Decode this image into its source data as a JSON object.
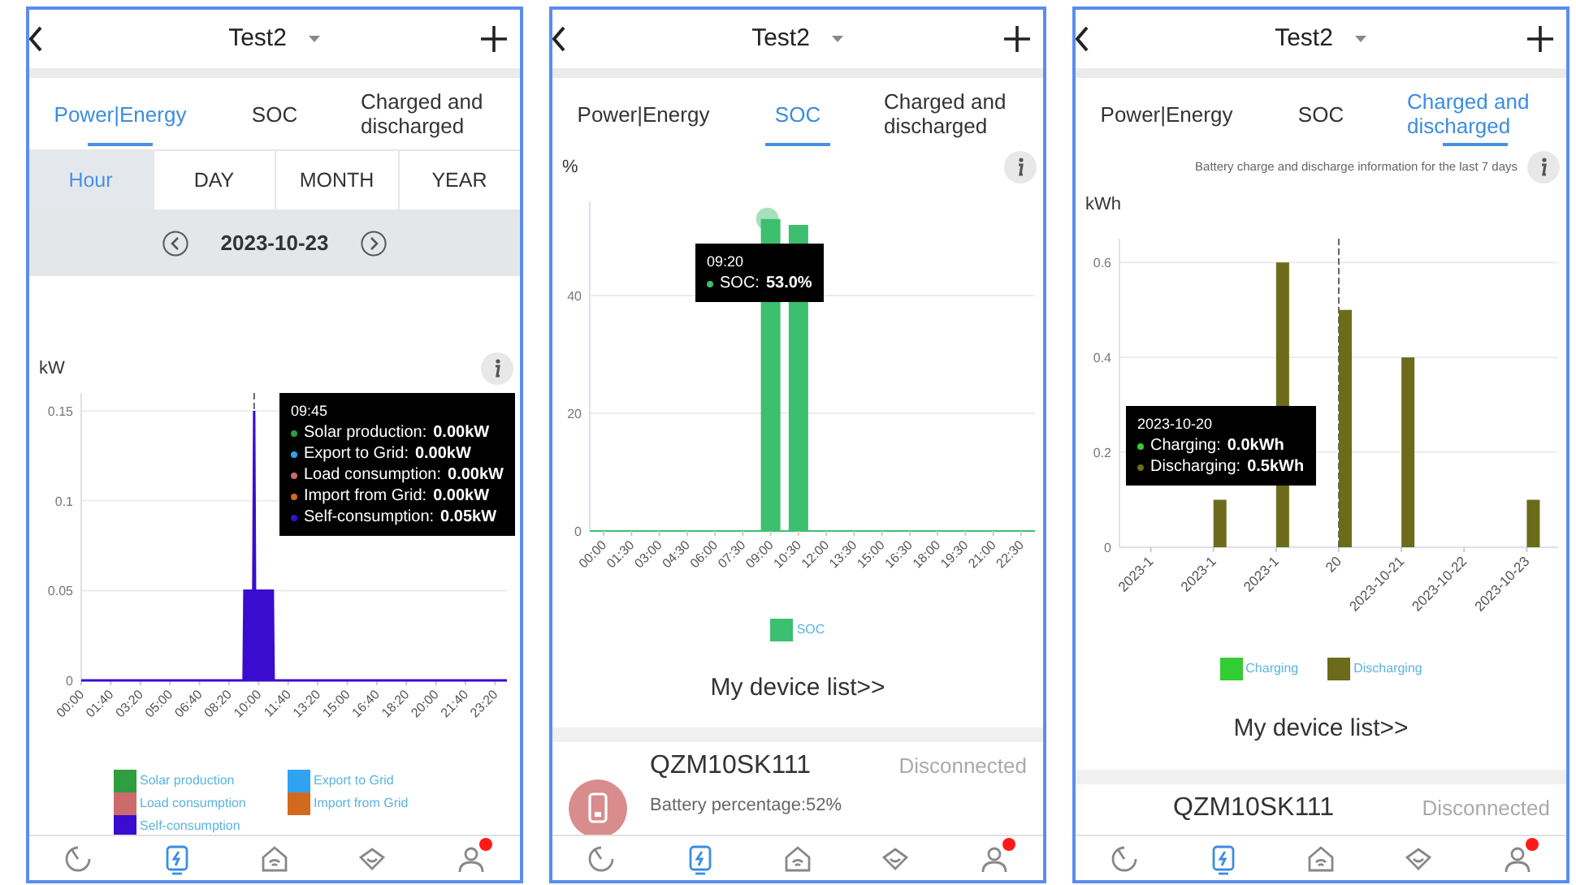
{
  "screens": [
    {
      "header": {
        "title": "Test2"
      },
      "tabs": [
        {
          "label": "Power|Energy",
          "selected": true
        },
        {
          "label": "SOC",
          "selected": false
        },
        {
          "label": "Charged and discharged",
          "selected": false
        }
      ],
      "periods": [
        {
          "label": "Hour",
          "selected": true
        },
        {
          "label": "DAY",
          "selected": false
        },
        {
          "label": "MONTH",
          "selected": false
        },
        {
          "label": "YEAR",
          "selected": false
        }
      ],
      "date": "2023-10-23",
      "unit": "kW",
      "chart_data": {
        "type": "area",
        "x": [
          0,
          9.15,
          9.2,
          9.7,
          9.75,
          9.8,
          10.8,
          10.85,
          24
        ],
        "xlim": [
          0,
          24
        ],
        "xticks": [
          {
            "value": 0,
            "label": "00:00"
          },
          {
            "value": 1.667,
            "label": "01:40"
          },
          {
            "value": 3.333,
            "label": "03:20"
          },
          {
            "value": 5,
            "label": "05:00"
          },
          {
            "value": 6.667,
            "label": "06:40"
          },
          {
            "value": 8.333,
            "label": "08:20"
          },
          {
            "value": 10,
            "label": "10:00"
          },
          {
            "value": 11.667,
            "label": "11:40"
          },
          {
            "value": 13.333,
            "label": "13:20"
          },
          {
            "value": 15,
            "label": "15:00"
          },
          {
            "value": 16.667,
            "label": "16:40"
          },
          {
            "value": 18.333,
            "label": "18:20"
          },
          {
            "value": 20,
            "label": "20:00"
          },
          {
            "value": 21.667,
            "label": "21:40"
          },
          {
            "value": 23.333,
            "label": "23:20"
          }
        ],
        "yticks": [
          0,
          0.05,
          0.1,
          0.15
        ],
        "ylim": [
          0,
          0.16
        ],
        "grid": true,
        "ref_lines": [
          {
            "axis": "x",
            "value": 9.75
          }
        ],
        "series": [
          {
            "name": "Solar production",
            "color": "#2e9e3e",
            "values": [
              null,
              null,
              null,
              null,
              null,
              null,
              null,
              null,
              null
            ]
          },
          {
            "name": "Export to Grid",
            "color": "#2fa3f0",
            "values": [
              null,
              null,
              null,
              null,
              null,
              null,
              null,
              null,
              null
            ]
          },
          {
            "name": "Load consumption",
            "color": "#cc6b6b",
            "values": [
              null,
              null,
              null,
              null,
              null,
              null,
              null,
              null,
              null
            ]
          },
          {
            "name": "Import from Grid",
            "color": "#d2691e",
            "values": [
              null,
              null,
              null,
              null,
              null,
              null,
              null,
              null,
              null
            ]
          },
          {
            "name": "Self-consumption",
            "color": "#3a0ccf",
            "values": [
              0,
              0,
              0.05,
              0.05,
              0.15,
              0.05,
              0.05,
              0,
              0
            ]
          }
        ]
      },
      "tooltip": {
        "title": "09:45",
        "lines": [
          {
            "label": "Solar production:",
            "value": "0.00kW",
            "color": "#2e9e3e"
          },
          {
            "label": "Export to Grid:",
            "value": "0.00kW",
            "color": "#2fa3f0"
          },
          {
            "label": "Load consumption:",
            "value": "0.00kW",
            "color": "#cc6b6b"
          },
          {
            "label": "Import from Grid:",
            "value": "0.00kW",
            "color": "#d2691e"
          },
          {
            "label": "Self-consumption:",
            "value": "0.05kW",
            "color": "#3a0ccf"
          }
        ]
      },
      "nav": [
        {
          "kind": "gauge",
          "selected": false,
          "badge": false
        },
        {
          "kind": "bolt",
          "selected": true,
          "badge": false
        },
        {
          "kind": "home",
          "selected": false,
          "badge": false
        },
        {
          "kind": "heart",
          "selected": false,
          "badge": false
        },
        {
          "kind": "user",
          "selected": false,
          "badge": true
        }
      ]
    },
    {
      "header": {
        "title": "Test2"
      },
      "tabs": [
        {
          "label": "Power|Energy",
          "selected": false
        },
        {
          "label": "SOC",
          "selected": true
        },
        {
          "label": "Charged and discharged",
          "selected": false
        }
      ],
      "unit": "%",
      "chart_data": {
        "type": "bar",
        "categories": [
          "00:00",
          "01:30",
          "03:00",
          "04:30",
          "06:00",
          "07:30",
          "09:00",
          "10:30",
          "12:00",
          "13:30",
          "15:00",
          "16:30",
          "18:00",
          "19:30",
          "21:00",
          "22:30"
        ],
        "yticks": [
          0,
          20,
          40
        ],
        "ylim": [
          0,
          56
        ],
        "grid": true,
        "series": [
          {
            "name": "SOC",
            "color": "#3cbf6e",
            "values": [
              null,
              null,
              null,
              null,
              null,
              null,
              53,
              52,
              null,
              null,
              null,
              null,
              null,
              null,
              null,
              null
            ]
          }
        ]
      },
      "tooltip": {
        "title": "09:20",
        "lines": [
          {
            "label": "SOC:",
            "value": "53.0%",
            "color": "#3cbf6e"
          }
        ]
      },
      "device_link": "My device list>>",
      "device": {
        "name": "QZM10SK111",
        "status": "Disconnected",
        "battery": "Battery percentage:52%"
      },
      "nav": [
        {
          "kind": "gauge",
          "selected": false,
          "badge": false
        },
        {
          "kind": "bolt",
          "selected": true,
          "badge": false
        },
        {
          "kind": "home",
          "selected": false,
          "badge": false
        },
        {
          "kind": "heart",
          "selected": false,
          "badge": false
        },
        {
          "kind": "user",
          "selected": false,
          "badge": true
        }
      ]
    },
    {
      "header": {
        "title": "Test2"
      },
      "tabs": [
        {
          "label": "Power|Energy",
          "selected": false
        },
        {
          "label": "SOC",
          "selected": false
        },
        {
          "label": "Charged and discharged",
          "selected": true
        }
      ],
      "subtitle": "Battery charge and discharge information for the last 7 days",
      "unit": "kWh",
      "chart_data": {
        "type": "bar",
        "categories": [
          "2023-1",
          "2023-1",
          "2023-1",
          "20",
          "2023-10-21",
          "2023-10-22",
          "2023-10-23"
        ],
        "yticks": [
          0,
          0.2,
          0.4,
          0.6
        ],
        "ylim": [
          0,
          0.65
        ],
        "grid": true,
        "ref_lines": [
          {
            "axis": "x",
            "value": "20"
          }
        ],
        "series": [
          {
            "name": "Charging",
            "color": "#33cc33",
            "values": [
              0,
              0,
              0,
              0,
              0,
              0,
              0
            ]
          },
          {
            "name": "Discharging",
            "color": "#6b6b1a",
            "values": [
              0,
              0.1,
              0.6,
              0.5,
              0.4,
              0,
              0.1
            ]
          }
        ]
      },
      "tooltip": {
        "title": "2023-10-20",
        "lines": [
          {
            "label": "Charging:",
            "value": "0.0kWh",
            "color": "#33cc33"
          },
          {
            "label": "Discharging:",
            "value": "0.5kWh",
            "color": "#6b6b1a"
          }
        ]
      },
      "device_link": "My device list>>",
      "device": {
        "name": "QZM10SK111",
        "status": "Disconnected"
      },
      "nav": [
        {
          "kind": "gauge",
          "selected": false,
          "badge": false
        },
        {
          "kind": "bolt",
          "selected": true,
          "badge": false
        },
        {
          "kind": "home",
          "selected": false,
          "badge": false
        },
        {
          "kind": "heart",
          "selected": false,
          "badge": false
        },
        {
          "kind": "user",
          "selected": false,
          "badge": true
        }
      ]
    }
  ]
}
